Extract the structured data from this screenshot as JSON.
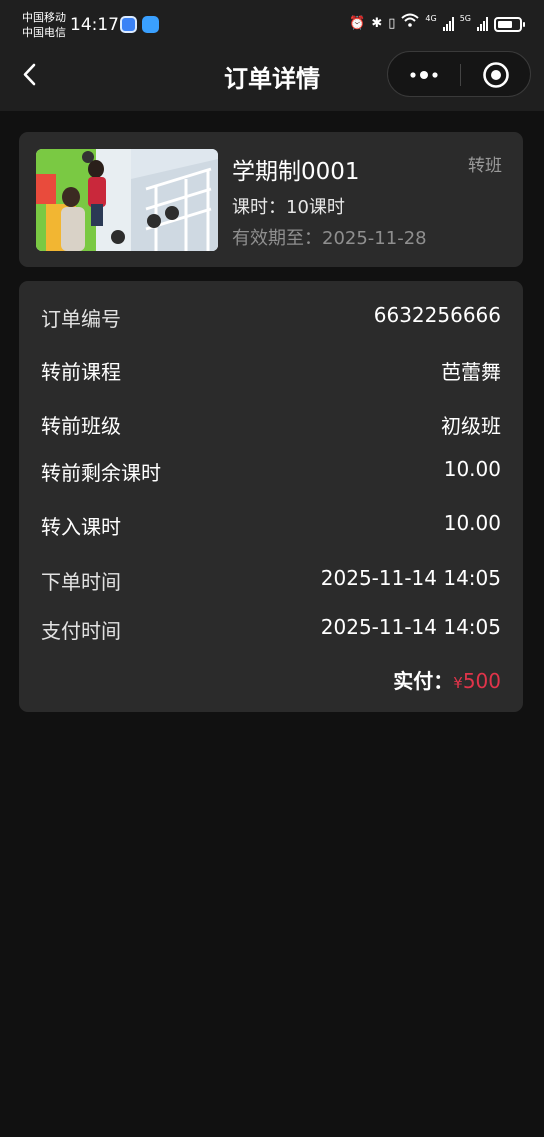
{
  "status_bar": {
    "carrier1": "中国移动",
    "carrier2": "中国电信",
    "time": "14:17",
    "network1": "4G",
    "network2": "5G"
  },
  "nav": {
    "title": "订单详情"
  },
  "course": {
    "name": "学期制0001",
    "tag": "转班",
    "hours": "课时：10课时",
    "expiry": "有效期至：2025-11-28"
  },
  "details": {
    "order_no_label": "订单编号",
    "order_no": "6632256666",
    "from_course_label": "转前课程",
    "from_course": "芭蕾舞",
    "from_class_label": "转前班级",
    "from_class": "初级班",
    "remaining_label": "转前剩余课时",
    "remaining": "10.00",
    "transfer_in_label": "转入课时",
    "transfer_in": "10.00",
    "order_time_label": "下单时间",
    "order_time": "2025-11-14 14:05",
    "pay_time_label": "支付时间",
    "pay_time": "2025-11-14 14:05",
    "paid_label": "实付：",
    "paid_symbol": "¥",
    "paid_amount": "500"
  },
  "colors": {
    "background": "#111111",
    "card": "#2b2b2b",
    "accent_price": "#e0344a"
  }
}
